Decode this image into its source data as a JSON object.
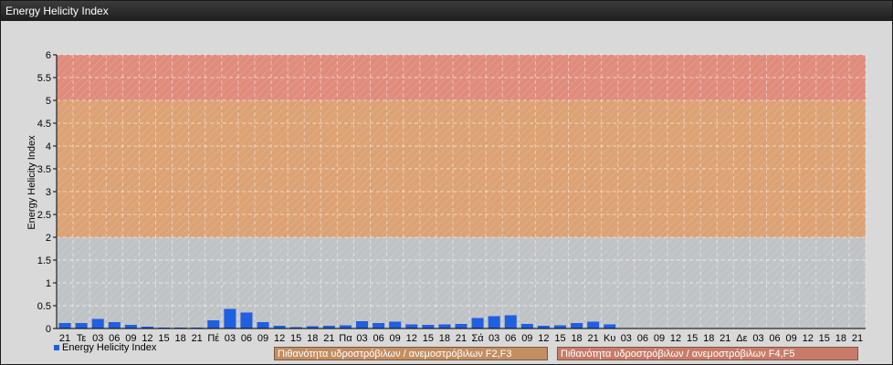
{
  "window": {
    "title": "Energy Helicity Index"
  },
  "chart_data": {
    "type": "bar",
    "ylabel": "Energy Helicity Index",
    "ylim": [
      0,
      6
    ],
    "yticks": [
      "0",
      "0.5",
      "1",
      "1.5",
      "2",
      "2.5",
      "3",
      "3.5",
      "4",
      "4.5",
      "5",
      "5.5",
      "6"
    ],
    "categories": [
      "21",
      "Τε",
      "03",
      "06",
      "09",
      "12",
      "15",
      "18",
      "21",
      "Πέ",
      "03",
      "06",
      "09",
      "12",
      "15",
      "18",
      "21",
      "Πα",
      "03",
      "06",
      "09",
      "12",
      "15",
      "18",
      "21",
      "Σά",
      "03",
      "06",
      "09",
      "12",
      "15",
      "18",
      "21",
      "Κυ",
      "03",
      "06",
      "09",
      "12",
      "15",
      "18",
      "21",
      "Δε",
      "03",
      "06",
      "09",
      "12",
      "15",
      "18",
      "21"
    ],
    "series": [
      {
        "name": "Energy Helicity Index",
        "values": [
          0.12,
          0.12,
          0.21,
          0.14,
          0.08,
          0.04,
          0.02,
          0.02,
          0.02,
          0.18,
          0.43,
          0.35,
          0.14,
          0.06,
          0.03,
          0.05,
          0.06,
          0.07,
          0.16,
          0.12,
          0.15,
          0.09,
          0.08,
          0.09,
          0.1,
          0.23,
          0.27,
          0.29,
          0.1,
          0.06,
          0.07,
          0.12,
          0.15,
          0.09,
          0.01,
          0.01,
          0.01,
          0.01,
          0.01,
          0.01,
          0.01,
          0.01,
          0.01,
          0.01,
          0.01,
          0.01,
          0.01,
          0.01,
          0.01
        ]
      }
    ],
    "bands": [
      {
        "from": 0,
        "to": 2,
        "color": "#c0c3c6"
      },
      {
        "from": 2,
        "to": 5,
        "color": "#dca274"
      },
      {
        "from": 5,
        "to": 6,
        "color": "#e08c7c"
      }
    ],
    "colors": {
      "bar": "#1f5fe0",
      "plot_background": "#c6c8ca"
    },
    "grid": true,
    "legend": {
      "series_label": "Energy Helicity Index",
      "band_label_f23": "Πιθανότητα υδροστρόβιλων / ανεμοστρόβιλων F2,F3",
      "band_label_f45": "Πιθανότητα υδροστρόβιλων / ανεμοστρόβιλων F4,F5"
    }
  }
}
